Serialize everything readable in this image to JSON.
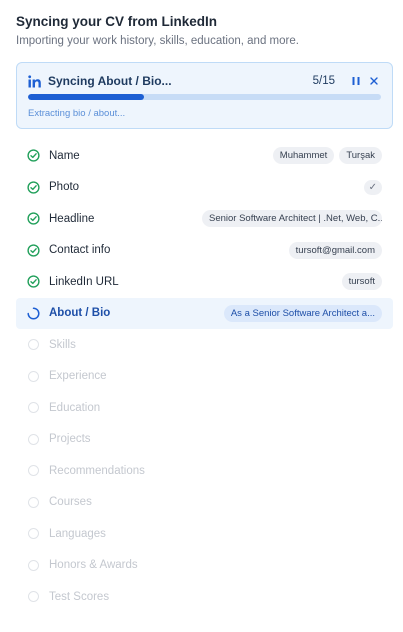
{
  "header": {
    "title": "Syncing your CV from LinkedIn",
    "subtitle": "Importing your work history, skills, education, and more."
  },
  "sync": {
    "label": "Syncing About / Bio...",
    "count": "5/15",
    "progress_fraction": 0.33,
    "status": "Extracting bio / about...",
    "icons": {
      "source": "linkedin-icon",
      "pause": "pause-icon",
      "close": "close-icon"
    },
    "accent": "#1d5fd3"
  },
  "items": [
    {
      "label": "Name",
      "state": "done",
      "chips": [
        "Muhammet",
        "Turşak"
      ]
    },
    {
      "label": "Photo",
      "state": "done",
      "chips": [
        "✓"
      ]
    },
    {
      "label": "Headline",
      "state": "done",
      "chips": [
        "Senior Software Architect | .Net, Web, C..."
      ]
    },
    {
      "label": "Contact info",
      "state": "done",
      "chips": [
        "tursoft@gmail.com"
      ]
    },
    {
      "label": "LinkedIn URL",
      "state": "done",
      "chips": [
        "tursoft"
      ]
    },
    {
      "label": "About / Bio",
      "state": "active",
      "chips": [
        "As a Senior Software Architect a..."
      ]
    },
    {
      "label": "Skills",
      "state": "pending",
      "chips": []
    },
    {
      "label": "Experience",
      "state": "pending",
      "chips": []
    },
    {
      "label": "Education",
      "state": "pending",
      "chips": []
    },
    {
      "label": "Projects",
      "state": "pending",
      "chips": []
    },
    {
      "label": "Recommendations",
      "state": "pending",
      "chips": []
    },
    {
      "label": "Courses",
      "state": "pending",
      "chips": []
    },
    {
      "label": "Languages",
      "state": "pending",
      "chips": []
    },
    {
      "label": "Honors & Awards",
      "state": "pending",
      "chips": []
    },
    {
      "label": "Test Scores",
      "state": "pending",
      "chips": []
    }
  ],
  "colors": {
    "done": "#22a05b",
    "active": "#1d5fd3",
    "pending": "#e0e3e8"
  }
}
